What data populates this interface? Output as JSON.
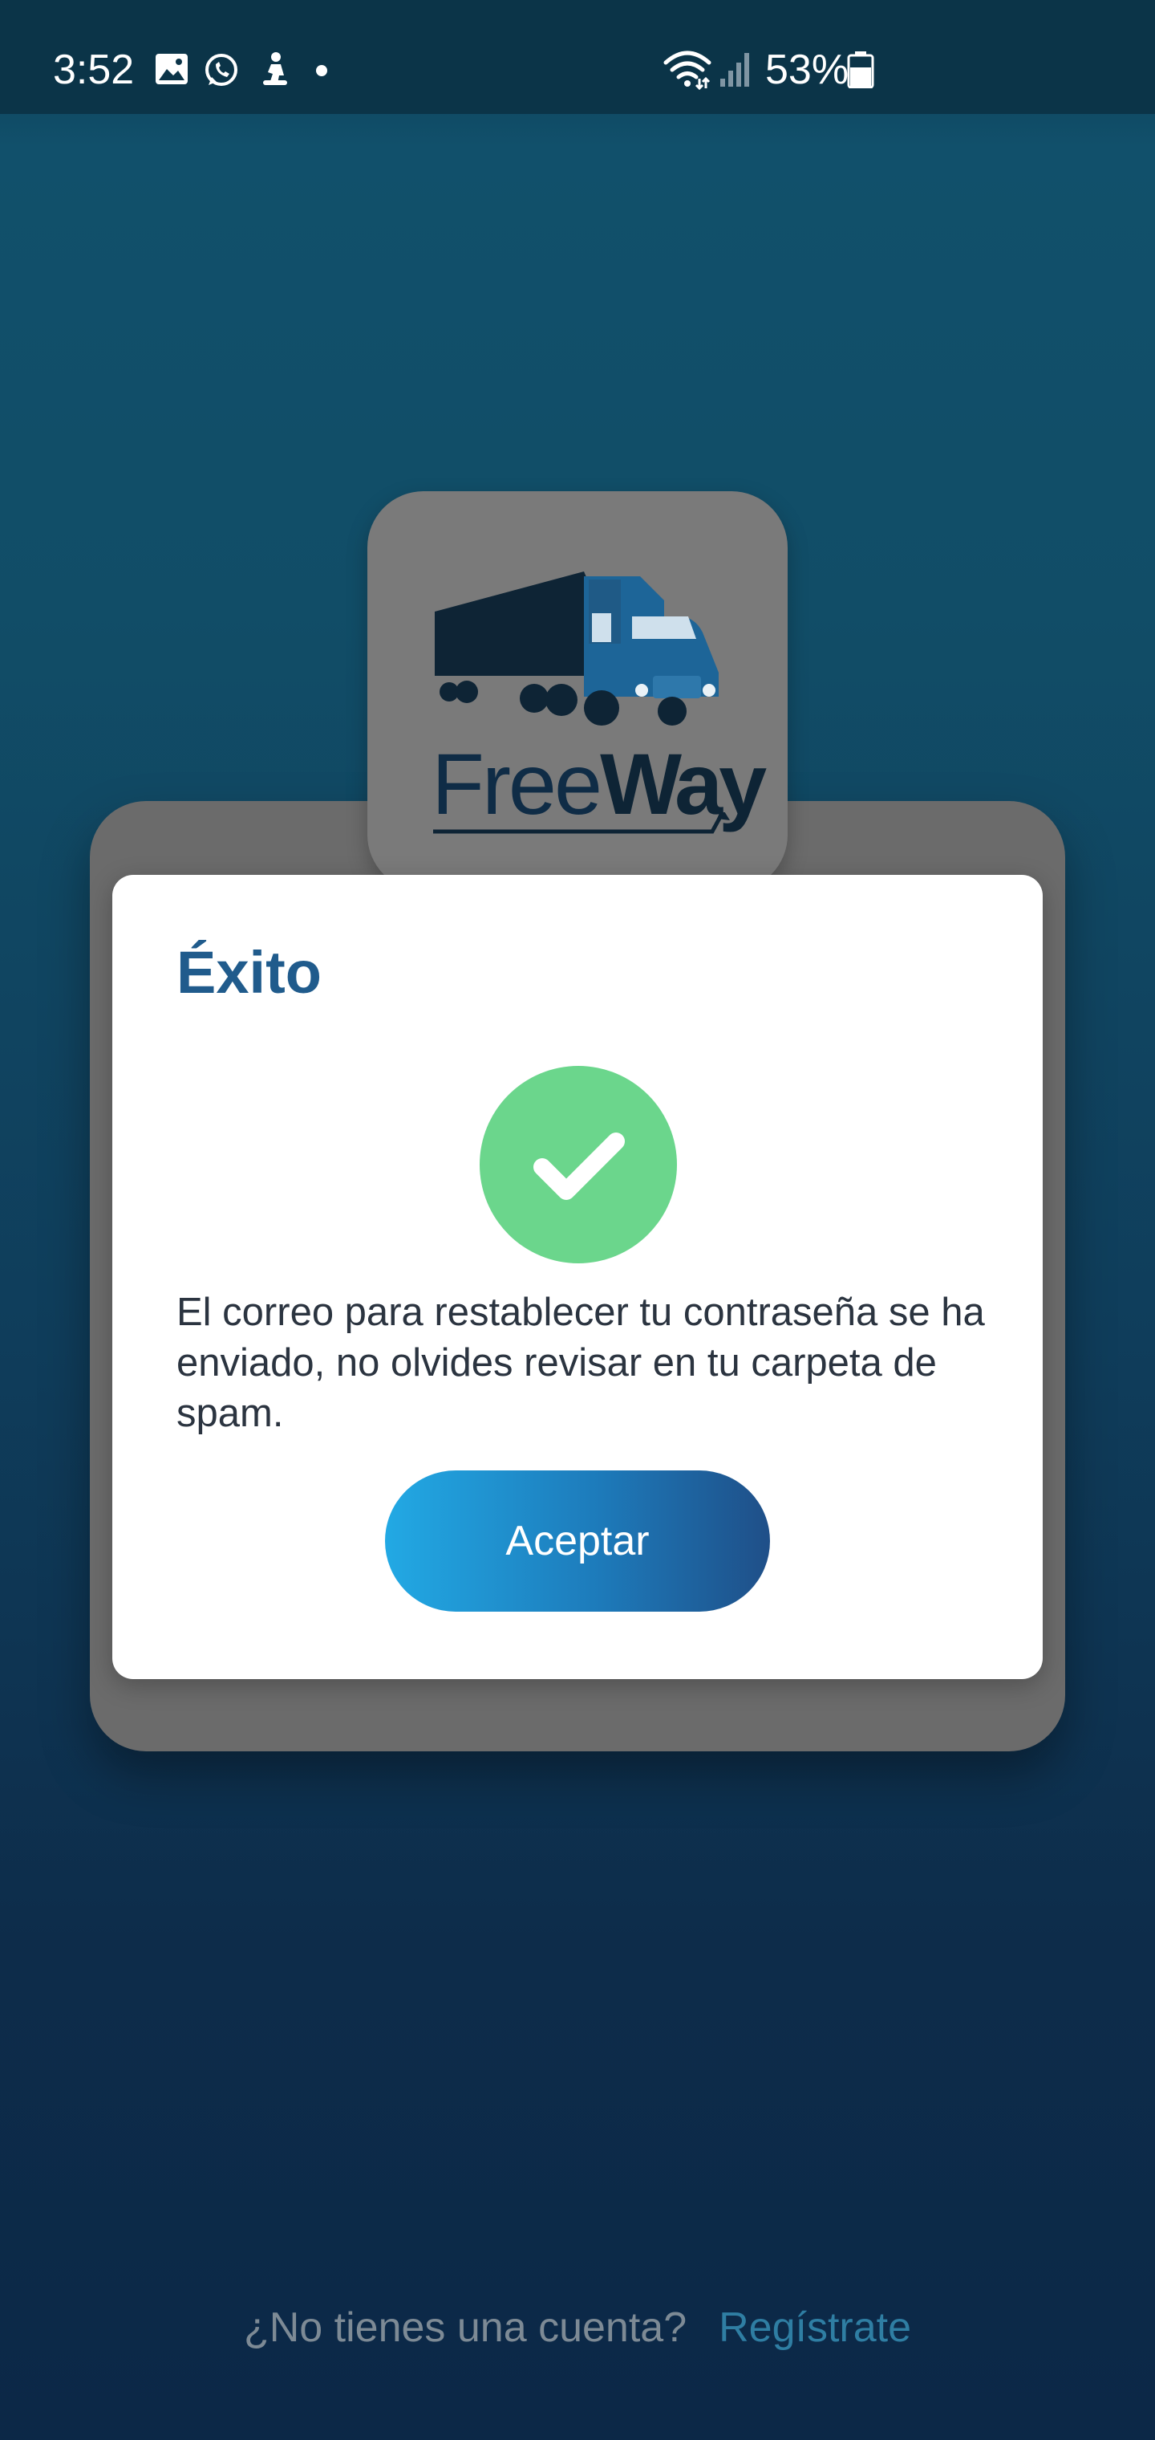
{
  "status_bar": {
    "time": "3:52",
    "battery_text": "53%",
    "icons": [
      "gallery-icon",
      "whatsapp-icon",
      "fitness-icon",
      "dot-icon",
      "wifi-icon",
      "signal-icon",
      "battery-icon"
    ]
  },
  "logo": {
    "wordmark_light": "Free",
    "wordmark_bold": "Way"
  },
  "dialog": {
    "title": "Éxito",
    "message": "El correo para restablecer tu contraseña se ha enviado, no olvides revisar en tu carpeta de spam.",
    "accept_label": "Aceptar",
    "success_color": "#6bd68c"
  },
  "footer": {
    "question": "¿No tienes una cuenta?",
    "register_label": "Regístrate"
  },
  "colors": {
    "title": "#205b8c",
    "button_start": "#22a9e4",
    "button_end": "#1f4f88",
    "background": "#114d67"
  }
}
